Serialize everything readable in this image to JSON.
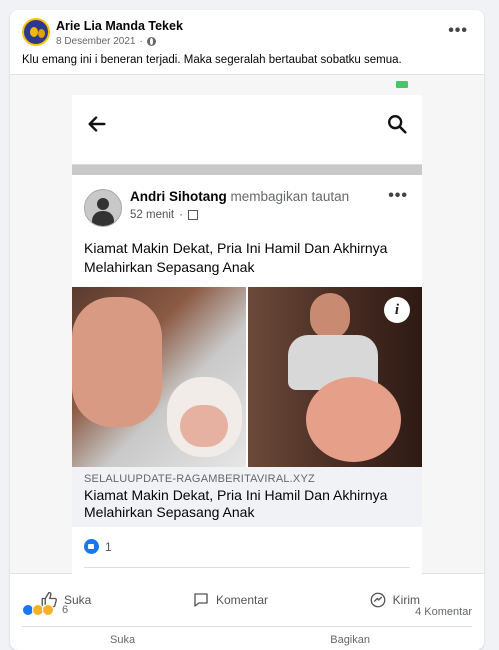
{
  "post": {
    "author": "Arie Lia Manda Tekek",
    "date": "8 Desember 2021",
    "separator": "·",
    "caption": "Klu emang ini i beneran terjadi. Maka segeralah bertaubat sobatku semua.",
    "more": "•••"
  },
  "screenshot": {
    "post": {
      "author": "Andri Sihotang",
      "action": "membagikan tautan",
      "time": "52 menit",
      "separator": "·",
      "more": "•••",
      "text": "Kiamat Makin Dekat, Pria Ini Hamil Dan Akhirnya Melahirkan Sepasang Anak",
      "link": {
        "domain": "SELALUUPDATE-RAGAMBERITAVIRAL.XYZ",
        "title": "Kiamat Makin Dekat, Pria Ini Hamil Dan Akhirnya Melahirkan Sepasang Anak"
      },
      "info_icon": "i",
      "reaction_count": "1"
    },
    "actions": {
      "like": "Suka",
      "comment": "Komentar",
      "share": "Kirim"
    }
  },
  "stats": {
    "reaction_count": "6",
    "comments": "4 Komentar"
  },
  "outer_actions": {
    "like": "Suka",
    "share": "Bagikan"
  },
  "colors": {
    "accent": "#1877f2",
    "background": "#f0f2f5"
  }
}
